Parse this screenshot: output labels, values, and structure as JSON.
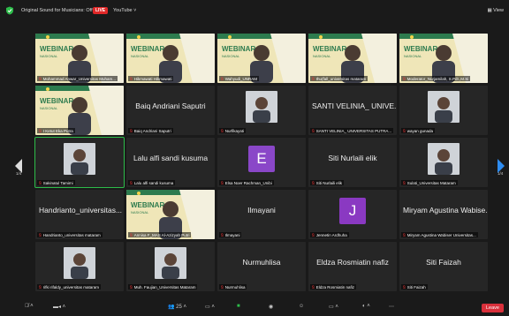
{
  "topbar": {
    "original_sound": "Original Sound for Musicians: Off",
    "live_badge": "LIVE",
    "youtube": "YouTube",
    "view": "View"
  },
  "pagination": {
    "left": "1/4",
    "right": "1/4"
  },
  "participants": [
    {
      "name": "Mohammad Anwar_Universitas Muham...",
      "kind": "webinar"
    },
    {
      "name": "Hikmawati Hikmawati",
      "kind": "webinar"
    },
    {
      "name": "Wahyudi_UNRAM",
      "kind": "webinar"
    },
    {
      "name": "Ihu(fall_universitas mataram",
      "kind": "webinar"
    },
    {
      "name": "Moderator_Nurjamilah, S.PdI.,M.Si",
      "kind": "webinar"
    },
    {
      "name": "I Ketut Eka Putra",
      "kind": "webinar"
    },
    {
      "name": "Baiq Andriani Saputri",
      "kind": "name",
      "big": "Baiq Andriani Saputri"
    },
    {
      "name": "Nurfikayati",
      "kind": "photo"
    },
    {
      "name": "SANTI VELINIA_ UNIVERSITAS PUTRA...",
      "kind": "name",
      "big": "SANTI VELINIA_ UNIVE..."
    },
    {
      "name": "wayan gunada",
      "kind": "photo"
    },
    {
      "name": "Sakinatul Tamimi",
      "kind": "photo",
      "active": true
    },
    {
      "name": "Lalu alfi sandi kusuma",
      "kind": "name",
      "big": "Lalu alfi sandi kusuma"
    },
    {
      "name": "Elsa Noer Rachman_Unibi",
      "kind": "letter",
      "letter": "E",
      "color": "#8a47c8"
    },
    {
      "name": "Siti Nurlaili elik",
      "kind": "name",
      "big": "Siti Nurlaili elik"
    },
    {
      "name": "Sulati_Universitas Mataram",
      "kind": "photo"
    },
    {
      "name": "Handrianto_universitas mataram",
      "kind": "name",
      "big": "Handrianto_universitas..."
    },
    {
      "name": "Annisa F_MAS Al-Azizyah Putri",
      "kind": "webinar"
    },
    {
      "name": "Ilmayani",
      "kind": "name",
      "big": "Ilmayani"
    },
    {
      "name": "Jennetin Ardhuha",
      "kind": "letter",
      "letter": "J",
      "color": "#8a39c2"
    },
    {
      "name": "Miryam Agustina Wabiser Universitas...",
      "kind": "name",
      "big": "Miryam Agustina Wabise..."
    },
    {
      "name": "rifki rifaldy_universitas mataram",
      "kind": "photo"
    },
    {
      "name": "Muh. Faujian_Universitas Mataram",
      "kind": "photo"
    },
    {
      "name": "Nurmuhlisa",
      "kind": "name",
      "big": "Nurmuhlisa"
    },
    {
      "name": "Eldza Rosmiatin nafiz",
      "kind": "name",
      "big": "Eldza Rosmiatin nafiz"
    },
    {
      "name": "Siti Faizah",
      "kind": "name",
      "big": "Siti Faizah"
    }
  ],
  "webinar_text": "WEBINAR",
  "webinar_sub": "NASIONAL",
  "bottombar": {
    "leave": "Leave",
    "participants_count": "25"
  }
}
